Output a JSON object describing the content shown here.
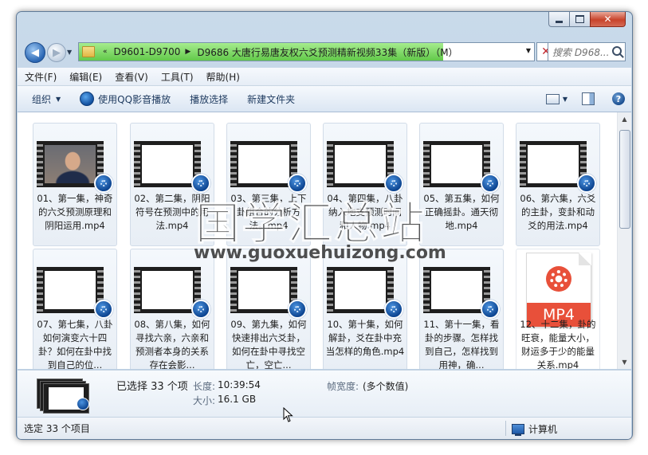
{
  "window": {
    "controls": {
      "minimize": "minimize",
      "maximize": "maximize",
      "close": "close"
    }
  },
  "nav": {
    "breadcrumb": [
      "D9601-D9700",
      "D9686 大唐行易唐友权六爻预测精新视频33集（新版）（M）"
    ],
    "search_placeholder": "搜索 D968...",
    "address_progress_percent": 80
  },
  "menu": [
    "文件(F)",
    "编辑(E)",
    "查看(V)",
    "工具(T)",
    "帮助(H)"
  ],
  "toolbar": {
    "organize": "组织",
    "play_qq": "使用QQ影音播放",
    "play_selection": "播放选择",
    "new_folder": "新建文件夹"
  },
  "files": [
    {
      "name": "01、第一集，神奇的六爻预测原理和阴阳运用.mp4",
      "thumb": "photo"
    },
    {
      "name": "02、第二集，阴阳符号在预测中的用法.mp4",
      "thumb": "blank"
    },
    {
      "name": "03、第三集，上下卦组合的分析方法。mp4",
      "thumb": "blank"
    },
    {
      "name": "04、第四集，八卦纳入地支预测时间和人物.mp4",
      "thumb": "blank"
    },
    {
      "name": "05、第五集，如何正确摇卦。通天彻地.mp4",
      "thumb": "blank"
    },
    {
      "name": "06、第六集，六爻的主卦，变卦和动爻的用法.mp4",
      "thumb": "blank"
    },
    {
      "name": "07、第七集，八卦如何演变六十四卦？如何在卦中找到自己的位...",
      "thumb": "blank"
    },
    {
      "name": "08、第八集，如何寻找六亲，六亲和预测者本身的关系存在会影...",
      "thumb": "blank"
    },
    {
      "name": "09、第九集，如何快速排出六爻卦，如何在卦中寻找空亡，空亡...",
      "thumb": "blank"
    },
    {
      "name": "10、第十集，如何解卦，爻在卦中充当怎样的角色.mp4",
      "thumb": "blank"
    },
    {
      "name": "11、第十一集，看卦的步骤。怎样找到自己，怎样找到用神，确...",
      "thumb": "blank"
    },
    {
      "name": "12、十二集，卦的旺衰，能量大小，财运多于少的能量关系.mp4",
      "thumb": "mp4",
      "icon_label": "MP4"
    }
  ],
  "watermark": {
    "title": "国学汇总站",
    "url": "www.guoxuehuizong.com"
  },
  "details": {
    "selected": "已选择 33 个项",
    "length_label": "长度:",
    "length_value": "10:39:54",
    "size_label": "大小:",
    "size_value": "16.1 GB",
    "frame_width_label": "帧宽度:",
    "frame_width_value": "(多个数值)"
  },
  "status": {
    "left": "选定 33 个项目",
    "right": "计算机"
  },
  "colors": {
    "accent": "#1e3a5f",
    "progress_green": "#62c94a",
    "mp4_orange": "#e8503a",
    "qq_blue": "#0d4591"
  }
}
